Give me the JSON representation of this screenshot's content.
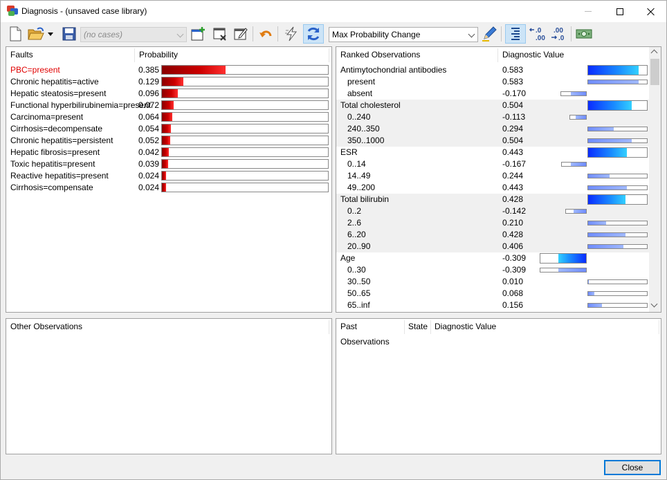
{
  "window": {
    "title": "Diagnosis - (unsaved case library)"
  },
  "toolbar": {
    "case_combo": "(no cases)",
    "strategy_combo": "Max Probability Change",
    "colors": {
      "accent": "#0078d7",
      "fault_bar": "#cc0000",
      "diag_bar": "#1a5fff"
    }
  },
  "faults": {
    "header_name": "Faults",
    "header_prob": "Probability",
    "items": [
      {
        "name": "PBC=present",
        "prob": "0.385",
        "value": 0.385,
        "highlight": true
      },
      {
        "name": "Chronic hepatitis=active",
        "prob": "0.129",
        "value": 0.129
      },
      {
        "name": "Hepatic steatosis=present",
        "prob": "0.096",
        "value": 0.096
      },
      {
        "name": "Functional hyperbilirubinemia=present",
        "prob": "0.072",
        "value": 0.072
      },
      {
        "name": "Carcinoma=present",
        "prob": "0.064",
        "value": 0.064
      },
      {
        "name": "Cirrhosis=decompensate",
        "prob": "0.054",
        "value": 0.054
      },
      {
        "name": "Chronic hepatitis=persistent",
        "prob": "0.052",
        "value": 0.052
      },
      {
        "name": "Hepatic fibrosis=present",
        "prob": "0.042",
        "value": 0.042
      },
      {
        "name": "Toxic hepatitis=present",
        "prob": "0.039",
        "value": 0.039
      },
      {
        "name": "Reactive hepatitis=present",
        "prob": "0.024",
        "value": 0.024
      },
      {
        "name": "Cirrhosis=compensate",
        "prob": "0.024",
        "value": 0.024
      }
    ]
  },
  "ranked": {
    "header_name": "Ranked Observations",
    "header_value": "Diagnostic Value",
    "items": [
      {
        "name": "Antimytochondrial antibodies",
        "value_text": "0.583",
        "value": 0.583,
        "kind": "group",
        "shaded": false
      },
      {
        "name": "present",
        "value_text": "0.583",
        "value": 0.583,
        "kind": "child",
        "shaded": false
      },
      {
        "name": "absent",
        "value_text": "-0.170",
        "value": -0.17,
        "kind": "child",
        "shaded": false
      },
      {
        "name": "Total cholesterol",
        "value_text": "0.504",
        "value": 0.504,
        "kind": "group",
        "shaded": true
      },
      {
        "name": "0..240",
        "value_text": "-0.113",
        "value": -0.113,
        "kind": "child",
        "shaded": true
      },
      {
        "name": "240..350",
        "value_text": "0.294",
        "value": 0.294,
        "kind": "child",
        "shaded": true
      },
      {
        "name": "350..1000",
        "value_text": "0.504",
        "value": 0.504,
        "kind": "child",
        "shaded": true
      },
      {
        "name": "ESR",
        "value_text": "0.443",
        "value": 0.443,
        "kind": "group",
        "shaded": false
      },
      {
        "name": "0..14",
        "value_text": "-0.167",
        "value": -0.167,
        "kind": "child",
        "shaded": false
      },
      {
        "name": "14..49",
        "value_text": "0.244",
        "value": 0.244,
        "kind": "child",
        "shaded": false
      },
      {
        "name": "49..200",
        "value_text": "0.443",
        "value": 0.443,
        "kind": "child",
        "shaded": false
      },
      {
        "name": "Total bilirubin",
        "value_text": "0.428",
        "value": 0.428,
        "kind": "group",
        "shaded": true
      },
      {
        "name": "0..2",
        "value_text": "-0.142",
        "value": -0.142,
        "kind": "child",
        "shaded": true
      },
      {
        "name": "2..6",
        "value_text": "0.210",
        "value": 0.21,
        "kind": "child",
        "shaded": true
      },
      {
        "name": "6..20",
        "value_text": "0.428",
        "value": 0.428,
        "kind": "child",
        "shaded": true
      },
      {
        "name": "20..90",
        "value_text": "0.406",
        "value": 0.406,
        "kind": "child",
        "shaded": true
      },
      {
        "name": "Age",
        "value_text": "-0.309",
        "value": -0.309,
        "kind": "group",
        "shaded": false
      },
      {
        "name": "0..30",
        "value_text": "-0.309",
        "value": -0.309,
        "kind": "child",
        "shaded": false
      },
      {
        "name": "30..50",
        "value_text": "0.010",
        "value": 0.01,
        "kind": "child",
        "shaded": false
      },
      {
        "name": "50..65",
        "value_text": "0.068",
        "value": 0.068,
        "kind": "child",
        "shaded": false
      },
      {
        "name": "65..inf",
        "value_text": "0.156",
        "value": 0.156,
        "kind": "child",
        "shaded": false
      }
    ]
  },
  "other": {
    "header": "Other Observations"
  },
  "past": {
    "header_name": "Past Observations",
    "header_state": "State",
    "header_value": "Diagnostic Value"
  },
  "footer": {
    "close_label": "Close"
  }
}
